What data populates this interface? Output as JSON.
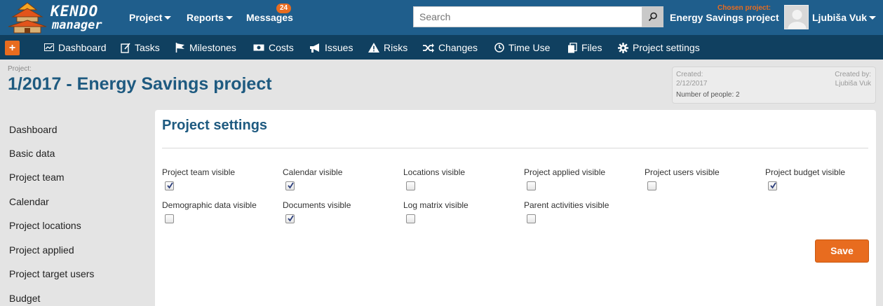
{
  "header": {
    "logo_line1": "KENDO",
    "logo_line2": "manager",
    "menu": [
      {
        "label": "Project"
      },
      {
        "label": "Reports"
      },
      {
        "label": "Messages",
        "badge": "24"
      }
    ],
    "search_placeholder": "Search",
    "chosen_project_label": "Chosen project:",
    "chosen_project_value": "Energy Savings project",
    "user_name": "Ljubiša Vuk"
  },
  "toolbar": {
    "items": [
      {
        "label": "Dashboard",
        "icon": "dashboard-icon"
      },
      {
        "label": "Tasks",
        "icon": "tasks-icon"
      },
      {
        "label": "Milestones",
        "icon": "flag-icon"
      },
      {
        "label": "Costs",
        "icon": "money-icon"
      },
      {
        "label": "Issues",
        "icon": "megaphone-icon"
      },
      {
        "label": "Risks",
        "icon": "warning-icon"
      },
      {
        "label": "Changes",
        "icon": "shuffle-icon"
      },
      {
        "label": "Time Use",
        "icon": "clock-icon"
      },
      {
        "label": "Files",
        "icon": "files-icon"
      },
      {
        "label": "Project settings",
        "icon": "gear-icon"
      }
    ]
  },
  "project": {
    "label": "Project:",
    "title": "1/2017 - Energy Savings project",
    "created_label": "Created:",
    "created_value": "2/12/2017",
    "created_by_label": "Created by:",
    "created_by_value": "Ljubiša Vuk",
    "people": "Number of people: 2"
  },
  "sidebar": {
    "items": [
      {
        "label": "Dashboard"
      },
      {
        "label": "Basic data"
      },
      {
        "label": "Project team"
      },
      {
        "label": "Calendar"
      },
      {
        "label": "Project locations"
      },
      {
        "label": "Project applied"
      },
      {
        "label": "Project target users"
      },
      {
        "label": "Budget"
      }
    ]
  },
  "settings": {
    "title": "Project settings",
    "options": [
      {
        "label": "Project team visible",
        "checked": true
      },
      {
        "label": "Calendar visible",
        "checked": true
      },
      {
        "label": "Locations visible",
        "checked": false
      },
      {
        "label": "Project applied visible",
        "checked": false
      },
      {
        "label": "Project users visible",
        "checked": false
      },
      {
        "label": "Project budget visible",
        "checked": true
      },
      {
        "label": "Demographic data visible",
        "checked": false
      },
      {
        "label": "Documents visible",
        "checked": true
      },
      {
        "label": "Log matrix visible",
        "checked": false
      },
      {
        "label": "Parent activities visible",
        "checked": false
      }
    ],
    "save_label": "Save"
  },
  "colors": {
    "topbar": "#1f5e8c",
    "navbar": "#104060",
    "accent": "#e86c1f",
    "title": "#1e5a80"
  }
}
